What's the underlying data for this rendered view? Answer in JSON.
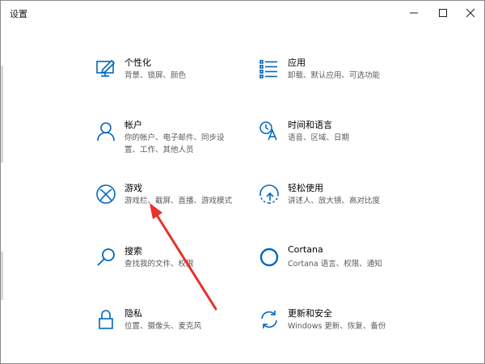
{
  "window": {
    "title": "设置",
    "controls": [
      "minimize",
      "maximize",
      "close"
    ]
  },
  "settings": [
    {
      "id": "personalization",
      "name": "个性化",
      "desc": [
        "背景、锁屏、颜色"
      ],
      "icon": "personalization-icon"
    },
    {
      "id": "apps",
      "name": "应用",
      "desc": [
        "卸载、默认应用、可选功能"
      ],
      "icon": "apps-list-icon"
    },
    {
      "id": "accounts",
      "name": "帐户",
      "desc": [
        "你的帐户、电子邮件、同步设",
        "置、工作、其他人员"
      ],
      "icon": "person-icon"
    },
    {
      "id": "time-language",
      "name": "时间和语言",
      "desc": [
        "语音、区域、日期"
      ],
      "icon": "time-language-icon"
    },
    {
      "id": "gaming",
      "name": "游戏",
      "desc": [
        "游戏栏、截屏、直播、游戏模式"
      ],
      "icon": "xbox-icon"
    },
    {
      "id": "ease-of-access",
      "name": "轻松使用",
      "desc": [
        "讲述人、放大镜、高对比度"
      ],
      "icon": "ease-of-access-icon"
    },
    {
      "id": "search",
      "name": "搜索",
      "desc": [
        "查找我的文件、权限"
      ],
      "icon": "search-icon"
    },
    {
      "id": "cortana",
      "name": "Cortana",
      "desc": [
        "Cortana 语言、权限、通知"
      ],
      "icon": "cortana-icon"
    },
    {
      "id": "privacy",
      "name": "隐私",
      "desc": [
        "位置、摄像头、麦克风"
      ],
      "icon": "lock-icon"
    },
    {
      "id": "update-security",
      "name": "更新和安全",
      "desc": [
        "Windows 更新、恢复、备份"
      ],
      "icon": "update-icon"
    }
  ],
  "colors": {
    "accent": "#0067c0",
    "annotation": "#e8312a"
  }
}
